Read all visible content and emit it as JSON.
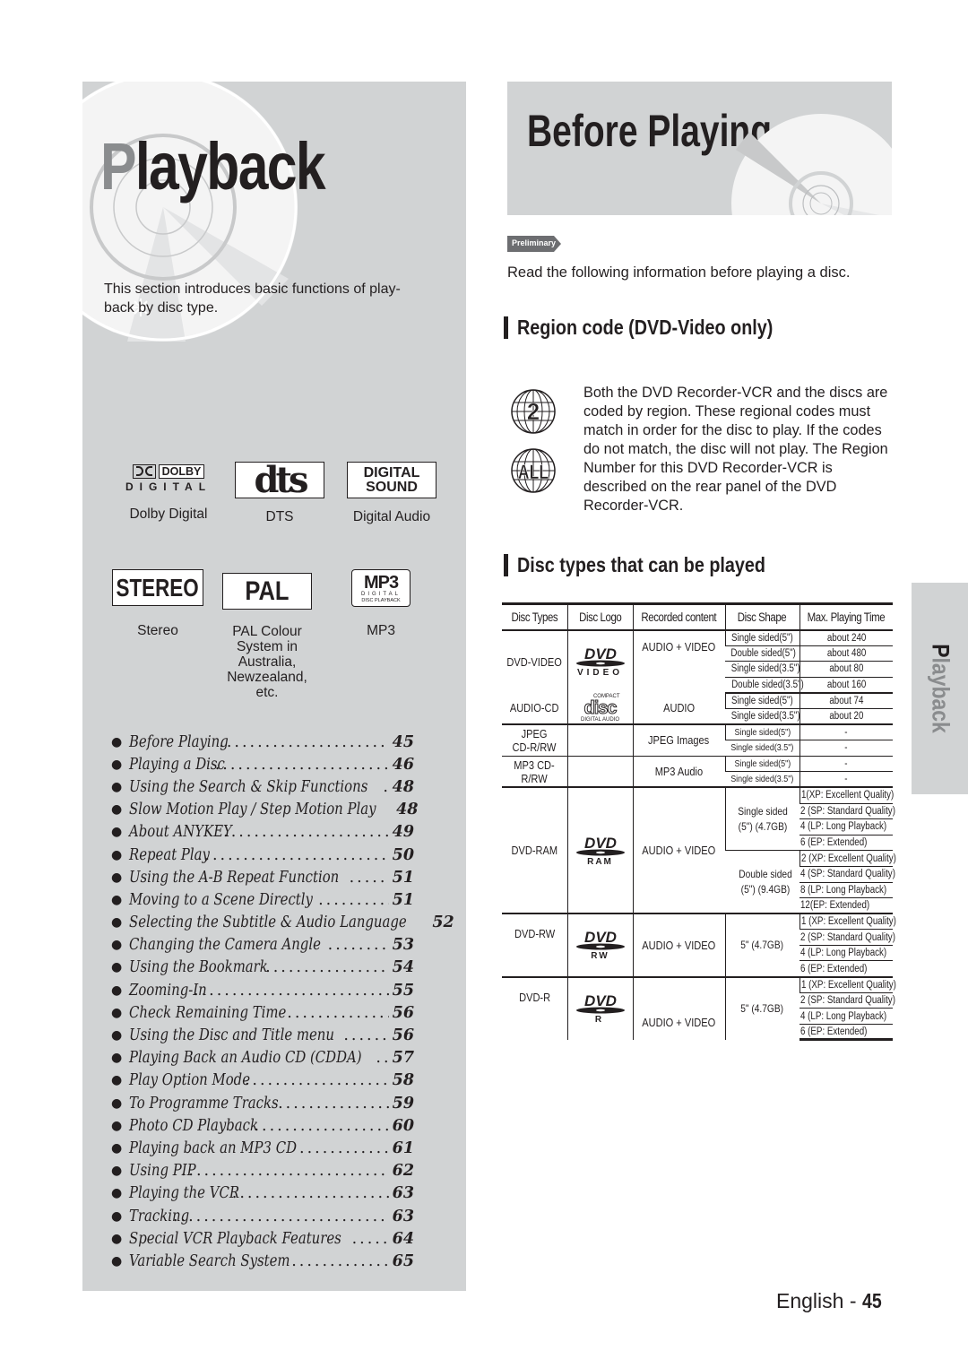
{
  "left_panel": {
    "title_first_letter": "P",
    "title_rest": "layback",
    "intro": "This section introduces basic functions of play-back by disc type.",
    "logos": [
      {
        "icon": "dolby-digital-logo",
        "logo_top": "DOLBY",
        "logo_bottom": "DIGITAL",
        "label": "Dolby Digital"
      },
      {
        "icon": "dts-logo",
        "logo_text": "dts",
        "label": "DTS"
      },
      {
        "icon": "digital-sound-logo",
        "logo_line1": "DIGITAL",
        "logo_line2": "SOUND",
        "label": "Digital Audio"
      },
      {
        "icon": "stereo-logo",
        "logo_text": "STEREO",
        "label": "Stereo"
      },
      {
        "icon": "pal-logo",
        "logo_text": "PAL",
        "label": "PAL Colour System in Australia, Newzealand, etc."
      },
      {
        "icon": "mp3-logo",
        "logo_top": "MP3",
        "logo_sub1": "DIGITAL",
        "logo_sub2": "DISC PLAYBACK",
        "label": "MP3"
      }
    ],
    "toc": [
      {
        "label": "Before Playing",
        "page": "45"
      },
      {
        "label": "Playing a Disc",
        "page": "46"
      },
      {
        "label": "Using the Search & Skip Functions",
        "page": "48"
      },
      {
        "label": "Slow Motion Play / Step Motion Play",
        "page": "48"
      },
      {
        "label": "About ANYKEY",
        "page": "49"
      },
      {
        "label": "Repeat Play",
        "page": "50"
      },
      {
        "label": "Using the A-B Repeat Function",
        "page": "51"
      },
      {
        "label": "Moving to a Scene Directly",
        "page": "51"
      },
      {
        "label": "Selecting the Subtitle & Audio Language",
        "page": "52"
      },
      {
        "label": "Changing the Camera Angle",
        "page": "53"
      },
      {
        "label": "Using the Bookmark",
        "page": "54"
      },
      {
        "label": "Zooming-In",
        "page": "55"
      },
      {
        "label": "Check Remaining Time",
        "page": "56"
      },
      {
        "label": "Using the Disc and Title menu",
        "page": "56"
      },
      {
        "label": "Playing Back an Audio CD (CDDA)",
        "page": "57"
      },
      {
        "label": "Play Option Mode",
        "page": "58"
      },
      {
        "label": "To Programme Tracks",
        "page": "59"
      },
      {
        "label": "Photo CD Playback",
        "page": "60"
      },
      {
        "label": "Playing back an MP3 CD",
        "page": "61"
      },
      {
        "label": "Using PIP",
        "page": "62"
      },
      {
        "label": "Playing the VCR",
        "page": "63"
      },
      {
        "label": "Tracking",
        "page": "63"
      },
      {
        "label": "Special VCR Playback Features",
        "page": "64"
      },
      {
        "label": "Variable Search System",
        "page": "65"
      }
    ]
  },
  "header": {
    "title": "Before Playing",
    "badge": "Preliminary",
    "intro": "Read the following information before playing a disc."
  },
  "region": {
    "heading": "Region code (DVD-Video only)",
    "icon_labels": [
      "2",
      "ALL"
    ],
    "body": "Both the DVD Recorder-VCR and the discs are coded by region. These regional codes must match in order for the disc to play. If the codes do not match, the disc will not play. The Region Number for this DVD Recorder-VCR is described on the rear panel of the DVD Recorder-VCR."
  },
  "disc_types": {
    "heading": "Disc types that can be played",
    "columns": [
      "Disc Types",
      "Disc Logo",
      "Recorded content",
      "Disc Shape",
      "Max. Playing Time"
    ],
    "rows": {
      "dvd_video": {
        "type": "DVD-VIDEO",
        "logo_sub": "VIDEO",
        "content": "AUDIO + VIDEO",
        "shapes": [
          "Single sided(5\")",
          "Double sided(5\")",
          "Single sided(3.5\")",
          "Double sided(3.5\")"
        ],
        "times": [
          "about 240",
          "about 480",
          "about 80",
          "about 160"
        ]
      },
      "audio_cd": {
        "type": "AUDIO-CD",
        "logo_top": "COMPACT",
        "logo_main": "disc",
        "logo_sub": "DIGITAL AUDIO",
        "content": "AUDIO",
        "shapes": [
          "Single sided(5\")",
          "Single sided(3.5\")"
        ],
        "times": [
          "about 74",
          "about 20"
        ]
      },
      "jpeg_cd": {
        "type": "JPEG CD-R/RW",
        "content": "JPEG Images",
        "shapes": [
          "Single sided(5\")",
          "Single sided(3.5\")"
        ],
        "times": [
          "-",
          "-"
        ]
      },
      "mp3_cd": {
        "type": "MP3 CD-R/RW",
        "content": "MP3 Audio",
        "shapes": [
          "Single sided(5\")",
          "Single sided(3.5\")"
        ],
        "times": [
          "-",
          "-"
        ]
      },
      "dvd_ram": {
        "type": "DVD-RAM",
        "logo_sub": "RAM",
        "content": "AUDIO + VIDEO",
        "shape_single": "Single sided (5\") (4.7GB)",
        "shape_double": "Double sided (5\") (9.4GB)",
        "modes_single": [
          "1(XP: Excellent Quality)",
          "2 (SP: Standard Quality)",
          "4 (LP: Long Playback)",
          "6 (EP: Extended)"
        ],
        "modes_double": [
          "2 (XP: Excellent Quality)",
          "4 (SP: Standard Quality)",
          "8 (LP: Long Playback)",
          "12(EP: Extended)"
        ]
      },
      "dvd_rw": {
        "type": "DVD-RW",
        "logo_sub": "RW",
        "content": "AUDIO + VIDEO",
        "shape": "5\" (4.7GB)",
        "modes": [
          "1 (XP: Excellent Quality)",
          "2 (SP: Standard Quality)",
          "4 (LP: Long Playback)",
          "6 (EP: Extended)"
        ]
      },
      "dvd_r": {
        "type": "DVD-R",
        "logo_sub": "R",
        "content": "AUDIO + VIDEO",
        "shape": "5\" (4.7GB)",
        "modes": [
          "1 (XP: Excellent Quality)",
          "2 (SP: Standard Quality)",
          "4 (LP: Long Playback)",
          "6 (EP: Extended)"
        ]
      }
    }
  },
  "side_tab": {
    "first_letter": "P",
    "rest": "layback"
  },
  "footer": {
    "language": "English",
    "separator": "-",
    "page": "45"
  },
  "colors": {
    "panel_gray": "#d1d3d4",
    "text": "#231f20",
    "muted_gray": "#8a8c8e",
    "badge_gray": "#6d6e71"
  }
}
